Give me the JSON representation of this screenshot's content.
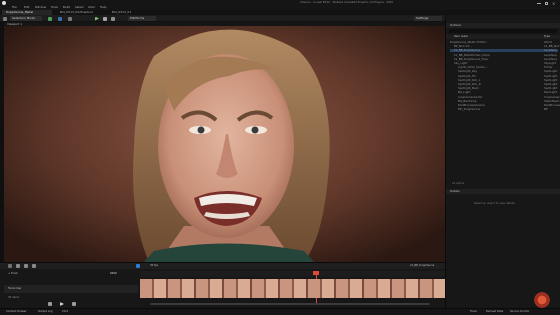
{
  "window": {
    "menu": [
      "File",
      "Edit",
      "Window",
      "Tools",
      "Build",
      "Select",
      "Actor",
      "Help"
    ],
    "tabs": [
      "DoppSenna_Metal",
      "Bld_0513_PerfCapture",
      "Bld_0513_01"
    ],
    "title_right": "Chevron - Unreal Editor - Multiple Unrelated Projects / All Plugins - 2024"
  },
  "toolbar": {
    "selection_mode": "Selection Mode",
    "platforms": "Platforms",
    "settings": "Settings"
  },
  "viewport": {
    "tab_label": "Viewport 1",
    "subject": "close-up of a woman with a snarling facial expression against a dark red-brown background"
  },
  "outliner": {
    "tab_label": "Outliner",
    "columns": [
      "Item Label",
      "Type"
    ],
    "rows": [
      {
        "label": "DoppSenna_Metal (Editor)",
        "type": "World"
      },
      {
        "label": "BP_Noir Int...",
        "type": "LS_BB_Noir"
      },
      {
        "label": "LS_BB_DoppSenna",
        "type": "LevelSeq"
      },
      {
        "label": "LS_BB_MetaHuman_Dopp",
        "type": "LevelSeq"
      },
      {
        "label": "LS_BB_DoppSenna_Face",
        "type": "LevelSeq"
      },
      {
        "label": "Sky_Light",
        "type": "SkyLight"
      },
      {
        "label": "Lights_Rfmt_Studio...",
        "type": "Folder"
      },
      {
        "label": "Spotlight_Key",
        "type": "SpotLight"
      },
      {
        "label": "Spotlight_Fill",
        "type": "SpotLight"
      },
      {
        "label": "Spotlight_Rim_L",
        "type": "SpotLight"
      },
      {
        "label": "Spotlight_Rim_R",
        "type": "SpotLight"
      },
      {
        "label": "Spotlight_Back",
        "type": "SpotLight"
      },
      {
        "label": "BG_Light",
        "type": "RectLight"
      },
      {
        "label": "CineCameraActor",
        "type": "CineCamera"
      },
      {
        "label": "BG_Backdrop",
        "type": "StaticMesh"
      },
      {
        "label": "PostProcessVolume",
        "type": "PostProcess"
      },
      {
        "label": "MH_DoppSenna",
        "type": "BP"
      }
    ],
    "count": "24 actors"
  },
  "details": {
    "tab_label": "Details",
    "empty_text": "Select an object to view details."
  },
  "sequencer": {
    "fps": "30 fps",
    "sequence_name": "LS_BB_DoppSenna",
    "current_frame": "0290",
    "track": "Facial Cap",
    "items_label": "36 items",
    "track_filter": "+ Track"
  },
  "statusbar": {
    "items": [
      "Content Drawer",
      "Output Log",
      "Cmd",
      "Trace",
      "Derived Data",
      "Source Control"
    ]
  },
  "colors": {
    "accent": "#2d7bd6",
    "playhead": "#e04a3a",
    "thumb_strip": "#c08a78"
  }
}
